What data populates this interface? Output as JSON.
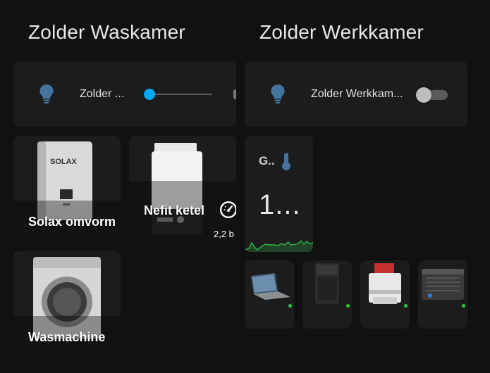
{
  "sections": {
    "waskamer": {
      "title": "Zolder Waskamer"
    },
    "werkkamer": {
      "title": "Zolder Werkkamer"
    }
  },
  "waskamer_light": {
    "label": "Zolder ...",
    "brightness": 0.0,
    "icon": "lightbulb-icon"
  },
  "werkkamer_light": {
    "label": "Zolder Werkkam...",
    "state": "off",
    "icon": "lightbulb-icon"
  },
  "pictures": {
    "solax": {
      "label": "Solax omvorm"
    },
    "nefit": {
      "label": "Nefit ketel",
      "pressure": "2,2 b",
      "icon": "gauge-icon"
    },
    "wasmachine": {
      "label": "Wasmachine"
    }
  },
  "sensor": {
    "name": "G..",
    "value": "1...",
    "icon": "thermometer-icon"
  },
  "devices": [
    {
      "name": "laptop",
      "status": "online"
    },
    {
      "name": "desktop-tower",
      "status": "online"
    },
    {
      "name": "printer",
      "status": "online"
    },
    {
      "name": "nas",
      "status": "online"
    }
  ],
  "colors": {
    "accent": "#03a9f4",
    "bulb": "#44739e",
    "graph": "#2fb84a",
    "online": "#2ecc40"
  }
}
